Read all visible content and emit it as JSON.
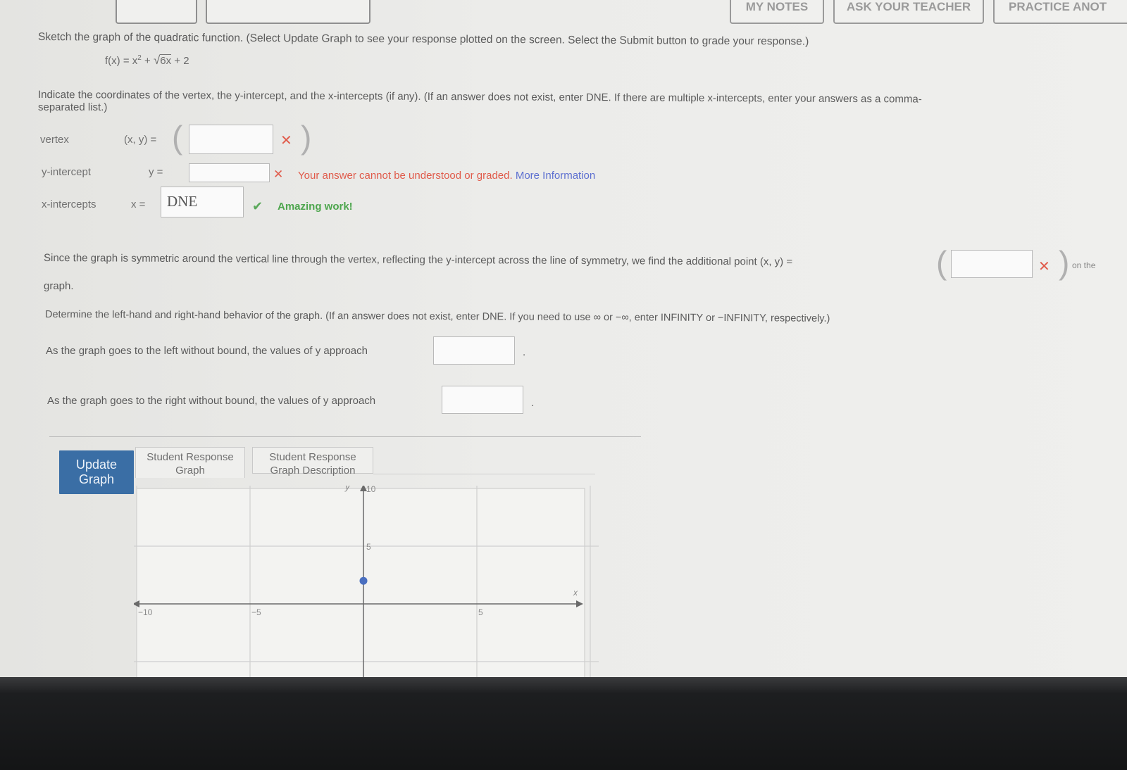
{
  "header": {
    "my_notes": "MY NOTES",
    "ask_teacher": "ASK YOUR TEACHER",
    "practice_another": "PRACTICE ANOT"
  },
  "question": {
    "instructions": "Sketch the graph of the quadratic function. (Select Update Graph to see your response plotted on the screen. Select the Submit button to grade your response.)",
    "function_lhs": "f(x) = x",
    "function_exp": "2",
    "function_mid": " + ",
    "function_sqrt_symbol": "√",
    "function_radicand": "6x",
    "function_tail": " + 2",
    "indicate_line1": "Indicate the coordinates of the vertex, the y-intercept, and the x-intercepts (if any). (If an answer does not exist, enter DNE. If there are multiple x-intercepts, enter your answers as a comma-",
    "indicate_line2": "separated list.)"
  },
  "answers": {
    "vertex_label": "vertex",
    "vertex_eq": "(x, y) =",
    "vertex_value": "",
    "yint_label": "y-intercept",
    "yint_eq": "y =",
    "yint_value": "",
    "yint_error": "Your answer cannot be understood or graded.",
    "yint_more_info": "More Information",
    "xint_label": "x-intercepts",
    "xint_eq": "x =",
    "xint_value": "DNE",
    "xint_feedback": "Amazing work!"
  },
  "symmetry": {
    "text": "Since the graph is symmetric around the vertical line through the vertex, reflecting the y-intercept across the line of symmetry, we find the additional point (x, y) =",
    "point_value": "",
    "on_the": "on the",
    "graph_word": "graph."
  },
  "behavior": {
    "instructions": "Determine the left-hand and right-hand behavior of the graph. (If an answer does not exist, enter DNE. If you need to use ∞ or −∞, enter INFINITY or −INFINITY, respectively.)",
    "left_text": "As the graph goes to the left without bound, the values of y approach",
    "left_value": "",
    "right_text": "As the graph goes to the right without bound, the values of y approach",
    "right_value": ""
  },
  "graph_tool": {
    "update_button": "Update Graph",
    "tab_graph_line1": "Student Response",
    "tab_graph_line2": "Graph",
    "tab_desc_line1": "Student Response",
    "tab_desc_line2": "Graph Description"
  },
  "chart_data": {
    "type": "scatter",
    "xlabel": "x",
    "ylabel": "y",
    "x_tick_labels": [
      "−10",
      "−5",
      "5"
    ],
    "y_tick_labels": [
      "5",
      "10"
    ],
    "points": [
      {
        "x": 0,
        "y": 2
      }
    ],
    "point_color": "#4a6fc0",
    "grid": true
  }
}
